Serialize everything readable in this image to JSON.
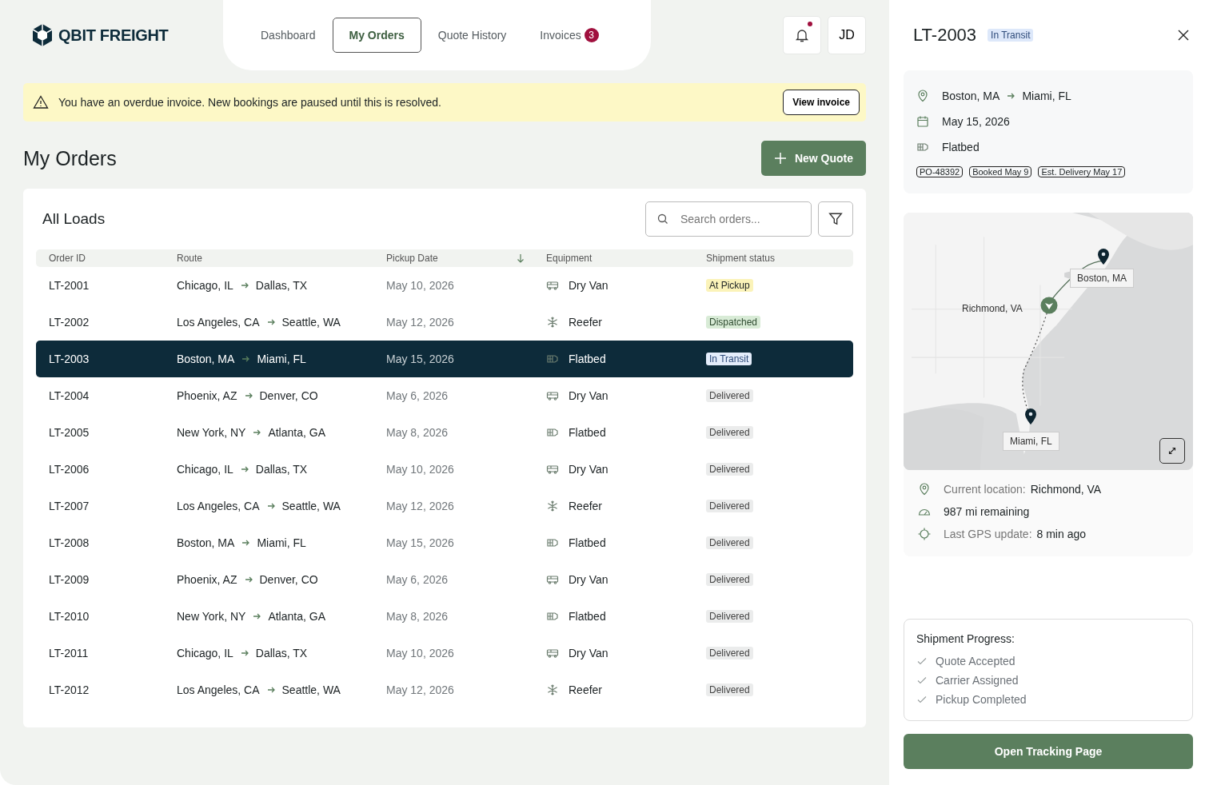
{
  "brand": {
    "name": "QBIT FREIGHT"
  },
  "nav": [
    {
      "label": "Dashboard",
      "selected": false
    },
    {
      "label": "My Orders",
      "selected": true
    },
    {
      "label": "Quote History",
      "selected": false
    },
    {
      "label": "Invoices",
      "selected": false,
      "badge": "3"
    }
  ],
  "notifications": {
    "unread": true
  },
  "avatar": {
    "initials": "JD"
  },
  "alert": {
    "message": "You have an overdue invoice. New bookings are paused until this is resolved.",
    "action": "View invoice"
  },
  "page_title": "My Orders",
  "new_quote_button": "New Quote",
  "table": {
    "title": "All Loads",
    "search": {
      "placeholder": "Search orders..."
    },
    "columns": [
      "Order ID",
      "Route",
      "Pickup Date",
      "Equipment",
      "Shipment status"
    ],
    "rows": [
      {
        "id": "LT-2001",
        "from": "Chicago, IL",
        "to": "Dallas, TX",
        "date": "May 10, 2026",
        "equipment": {
          "label": "Dry Van",
          "kind": "van"
        },
        "status": {
          "label": "At Pickup",
          "kind": "pickup"
        },
        "selected": false
      },
      {
        "id": "LT-2002",
        "from": "Los Angeles, CA",
        "to": "Seattle, WA",
        "date": "May 12, 2026",
        "equipment": {
          "label": "Reefer",
          "kind": "reefer"
        },
        "status": {
          "label": "Dispatched",
          "kind": "dispatched"
        },
        "selected": false
      },
      {
        "id": "LT-2003",
        "from": "Boston, MA",
        "to": "Miami, FL",
        "date": "May 15, 2026",
        "equipment": {
          "label": "Flatbed",
          "kind": "flatbed"
        },
        "status": {
          "label": "In Transit",
          "kind": "transit"
        },
        "selected": true
      },
      {
        "id": "LT-2004",
        "from": "Phoenix, AZ",
        "to": "Denver, CO",
        "date": "May 6, 2026",
        "equipment": {
          "label": "Dry Van",
          "kind": "van"
        },
        "status": {
          "label": "Delivered",
          "kind": "delivered"
        },
        "selected": false
      },
      {
        "id": "LT-2005",
        "from": "New York, NY",
        "to": "Atlanta, GA",
        "date": "May 8, 2026",
        "equipment": {
          "label": "Flatbed",
          "kind": "flatbed"
        },
        "status": {
          "label": "Delivered",
          "kind": "delivered"
        },
        "selected": false
      },
      {
        "id": "LT-2006",
        "from": "Chicago, IL",
        "to": "Dallas, TX",
        "date": "May 10, 2026",
        "equipment": {
          "label": "Dry Van",
          "kind": "van"
        },
        "status": {
          "label": "Delivered",
          "kind": "delivered"
        },
        "selected": false
      },
      {
        "id": "LT-2007",
        "from": "Los Angeles, CA",
        "to": "Seattle, WA",
        "date": "May 12, 2026",
        "equipment": {
          "label": "Reefer",
          "kind": "reefer"
        },
        "status": {
          "label": "Delivered",
          "kind": "delivered"
        },
        "selected": false
      },
      {
        "id": "LT-2008",
        "from": "Boston, MA",
        "to": "Miami, FL",
        "date": "May 15, 2026",
        "equipment": {
          "label": "Flatbed",
          "kind": "flatbed"
        },
        "status": {
          "label": "Delivered",
          "kind": "delivered"
        },
        "selected": false
      },
      {
        "id": "LT-2009",
        "from": "Phoenix, AZ",
        "to": "Denver, CO",
        "date": "May 6, 2026",
        "equipment": {
          "label": "Dry Van",
          "kind": "van"
        },
        "status": {
          "label": "Delivered",
          "kind": "delivered"
        },
        "selected": false
      },
      {
        "id": "LT-2010",
        "from": "New York, NY",
        "to": "Atlanta, GA",
        "date": "May 8, 2026",
        "equipment": {
          "label": "Flatbed",
          "kind": "flatbed"
        },
        "status": {
          "label": "Delivered",
          "kind": "delivered"
        },
        "selected": false
      },
      {
        "id": "LT-2011",
        "from": "Chicago, IL",
        "to": "Dallas, TX",
        "date": "May 10, 2026",
        "equipment": {
          "label": "Dry Van",
          "kind": "van"
        },
        "status": {
          "label": "Delivered",
          "kind": "delivered"
        },
        "selected": false
      },
      {
        "id": "LT-2012",
        "from": "Los Angeles, CA",
        "to": "Seattle, WA",
        "date": "May 12, 2026",
        "equipment": {
          "label": "Reefer",
          "kind": "reefer"
        },
        "status": {
          "label": "Delivered",
          "kind": "delivered"
        },
        "selected": false
      }
    ]
  },
  "detail": {
    "title": "LT-2003",
    "status": {
      "label": "In Transit",
      "kind": "transit"
    },
    "from": "Boston, MA",
    "to": "Miami, FL",
    "date": "May 15, 2026",
    "equipment": {
      "label": "Flatbed",
      "kind": "flatbed"
    },
    "tags": [
      "PO-48392",
      "Booked May 9",
      "Est. Delivery May 17"
    ],
    "map": {
      "kind": "picture",
      "labels": [
        "Boston, MA",
        "Richmond, VA",
        "Miami, FL"
      ]
    },
    "current_location_label": "Current location:",
    "current_location": "Richmond, VA",
    "remaining": "987 mi remaining",
    "gps_label": "Last GPS update:",
    "gps": "8 min ago",
    "progress_title": "Shipment Progress:",
    "steps": [
      {
        "label": "Quote Accepted",
        "done": true
      },
      {
        "label": "Carrier Assigned",
        "done": true
      },
      {
        "label": "Pickup Completed",
        "done": true
      }
    ],
    "tracking_button": "Open Tracking Page"
  }
}
